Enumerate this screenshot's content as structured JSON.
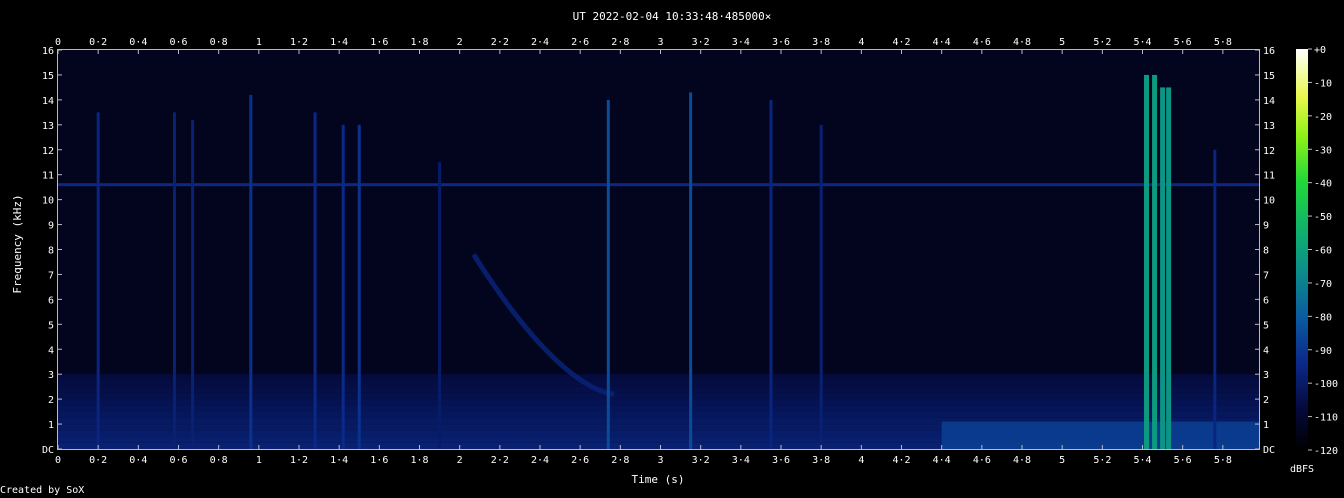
{
  "chart_data": {
    "type": "heatmap",
    "title": "UT 2022-02-04 10:33:48·485000×",
    "xlabel": "Time (s)",
    "ylabel": "Frequency (kHz)",
    "x_ticks": [
      "0",
      "0·2",
      "0·4",
      "0·6",
      "0·8",
      "1",
      "1·2",
      "1·4",
      "1·6",
      "1·8",
      "2",
      "2·2",
      "2·4",
      "2·6",
      "2·8",
      "3",
      "3·2",
      "3·4",
      "3·6",
      "3·8",
      "4",
      "4·2",
      "4·4",
      "4·6",
      "4·8",
      "5",
      "5·2",
      "5·4",
      "5·6",
      "5·8"
    ],
    "y_ticks": [
      "DC",
      "1",
      "2",
      "3",
      "4",
      "5",
      "6",
      "7",
      "8",
      "9",
      "10",
      "11",
      "12",
      "13",
      "14",
      "15",
      "16"
    ],
    "xlim": [
      0,
      5.98
    ],
    "ylim": [
      0,
      16
    ],
    "colorbar": {
      "label": "dBFS",
      "ticks": [
        "+0",
        "-10",
        "-20",
        "-30",
        "-40",
        "-50",
        "-60",
        "-70",
        "-80",
        "-90",
        "-100",
        "-110",
        "-120"
      ],
      "range": [
        -120,
        0
      ]
    },
    "features": {
      "noise_floor_dbfs": -108,
      "horizontal_line": {
        "freq_khz": 10.6,
        "level_dbfs": -95
      },
      "low_band": {
        "freq_range_khz": [
          0,
          3
        ],
        "level_dbfs": -98
      },
      "spikes": [
        {
          "t": 0.2,
          "top_khz": 13.5,
          "level_dbfs": -96
        },
        {
          "t": 0.58,
          "top_khz": 13.5,
          "level_dbfs": -98
        },
        {
          "t": 0.67,
          "top_khz": 13.2,
          "level_dbfs": -98
        },
        {
          "t": 0.96,
          "top_khz": 14.2,
          "level_dbfs": -92
        },
        {
          "t": 1.28,
          "top_khz": 13.5,
          "level_dbfs": -95
        },
        {
          "t": 1.42,
          "top_khz": 13.0,
          "level_dbfs": -94
        },
        {
          "t": 1.5,
          "top_khz": 13.0,
          "level_dbfs": -92
        },
        {
          "t": 1.9,
          "top_khz": 11.5,
          "level_dbfs": -100
        },
        {
          "t": 2.74,
          "top_khz": 14.0,
          "level_dbfs": -84
        },
        {
          "t": 3.15,
          "top_khz": 14.3,
          "level_dbfs": -84
        },
        {
          "t": 3.55,
          "top_khz": 14.0,
          "level_dbfs": -96
        },
        {
          "t": 3.8,
          "top_khz": 13.0,
          "level_dbfs": -98
        },
        {
          "t": 5.42,
          "top_khz": 15.0,
          "level_dbfs": -62
        },
        {
          "t": 5.46,
          "top_khz": 15.0,
          "level_dbfs": -62
        },
        {
          "t": 5.5,
          "top_khz": 14.5,
          "level_dbfs": -64
        },
        {
          "t": 5.53,
          "top_khz": 14.5,
          "level_dbfs": -64
        },
        {
          "t": 5.76,
          "top_khz": 12.0,
          "level_dbfs": -96
        }
      ],
      "chirp": {
        "t_start": 2.07,
        "f_start_khz": 7.8,
        "t_end": 2.77,
        "f_end_khz": 2.2,
        "level_dbfs": -98
      },
      "late_band": {
        "t_start": 4.4,
        "freq_range_khz": [
          0,
          1.1
        ],
        "level_dbfs": -88
      }
    }
  },
  "credit": "Created by SoX"
}
